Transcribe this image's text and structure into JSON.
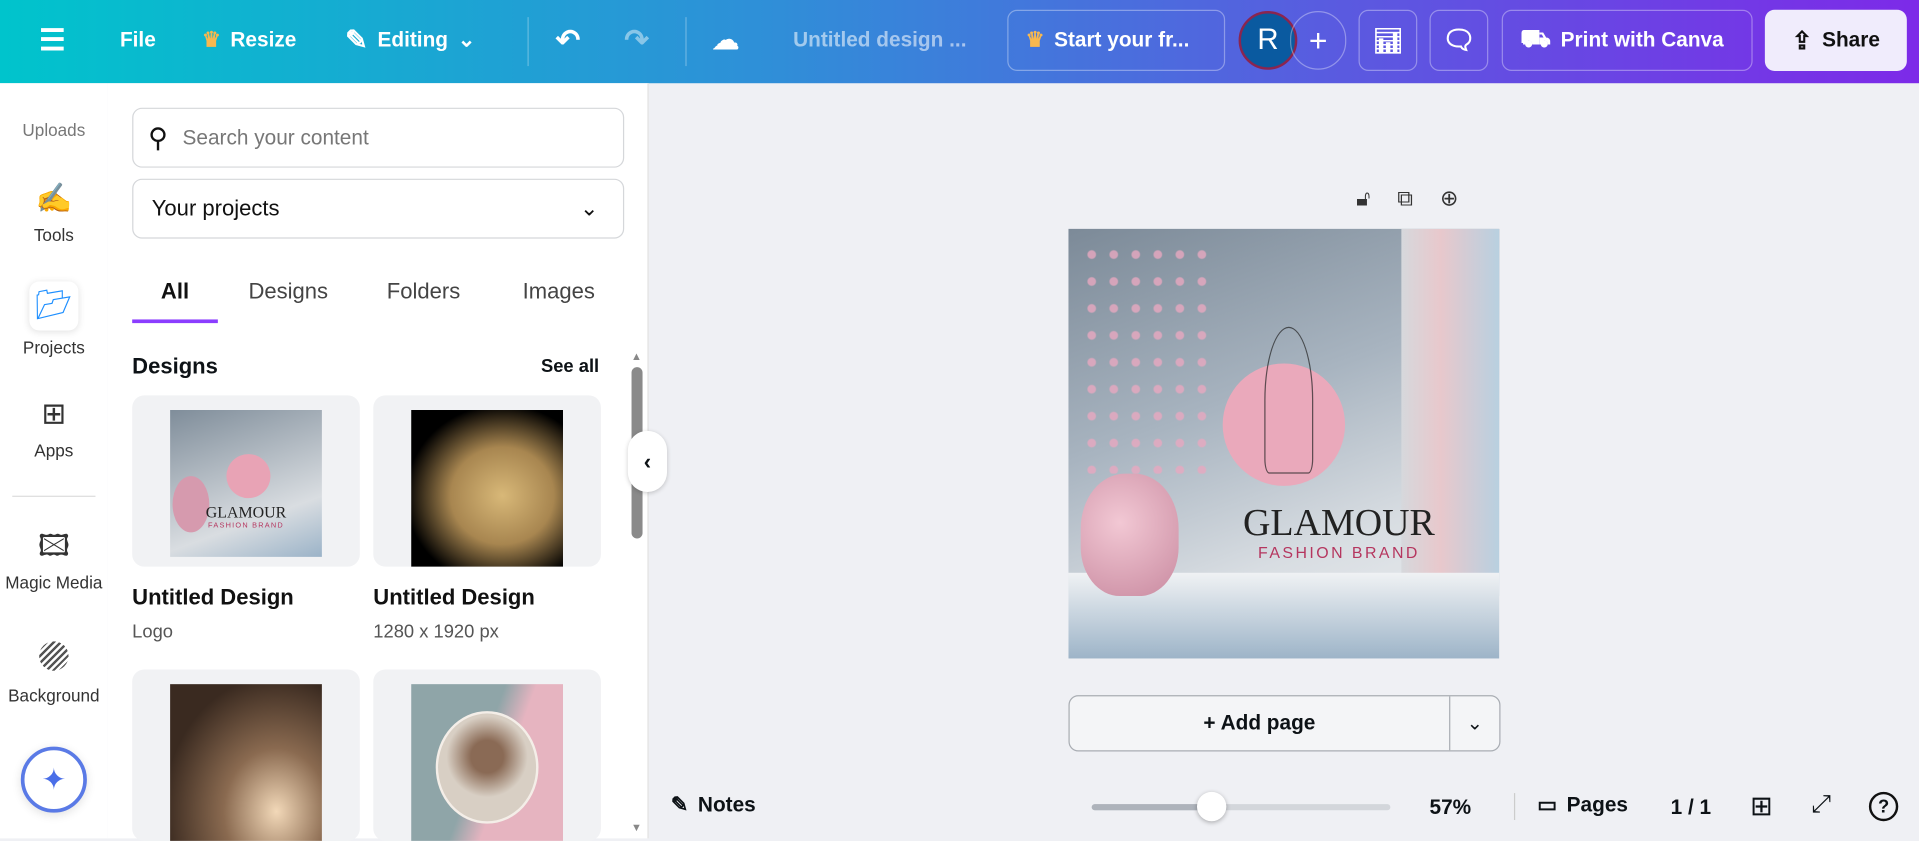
{
  "topbar": {
    "file": "File",
    "resize": "Resize",
    "editing": "Editing",
    "title": "Untitled design ...",
    "trial": "Start your fr...",
    "avatar": "R",
    "print": "Print with Canva",
    "share": "Share"
  },
  "leftnav": [
    {
      "label": "Uploads"
    },
    {
      "label": "Tools"
    },
    {
      "label": "Projects"
    },
    {
      "label": "Apps"
    },
    {
      "label": "Magic Media"
    },
    {
      "label": "Background"
    }
  ],
  "panel": {
    "search_placeholder": "Search your content",
    "select": "Your projects",
    "tabs": [
      "All",
      "Designs",
      "Folders",
      "Images"
    ],
    "section": "Designs",
    "see_all": "See all",
    "designs": [
      {
        "title": "Untitled Design",
        "sub": "Logo"
      },
      {
        "title": "Untitled Design",
        "sub": "1280 x 1920 px"
      }
    ]
  },
  "canvas": {
    "brand": "GLAMOUR",
    "tagline": "FASHION BRAND",
    "thumb_brand": "GLAMOUR",
    "thumb_tagline": "FASHION BRAND",
    "add_page": "+ Add page"
  },
  "footer": {
    "notes": "Notes",
    "zoom": "57%",
    "zoom_fraction": 0.4,
    "pages": "Pages",
    "page_count": "1 / 1"
  },
  "colors": {
    "accent": "#8b3dff",
    "brand_pink": "#b5365f"
  }
}
